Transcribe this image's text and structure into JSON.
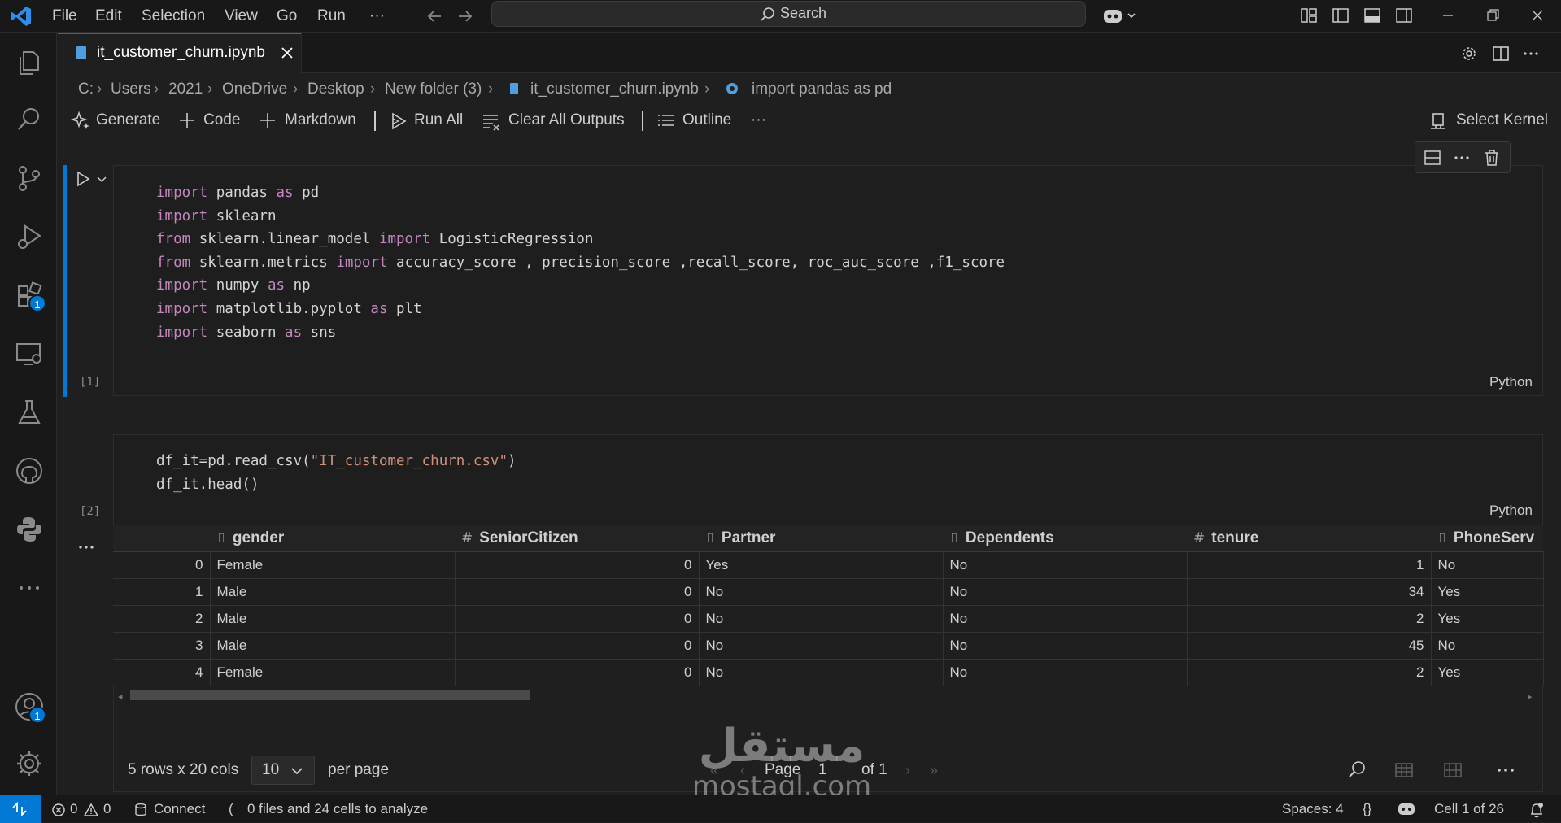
{
  "menu": [
    "File",
    "Edit",
    "Selection",
    "View",
    "Go",
    "Run",
    "···"
  ],
  "search": {
    "label": "Search"
  },
  "tab": {
    "title": "it_customer_churn.ipynb"
  },
  "breadcrumb": [
    "C:",
    "Users",
    "2021",
    "OneDrive",
    "Desktop",
    "New folder (3)",
    "it_customer_churn.ipynb",
    "import pandas as pd"
  ],
  "toolbar": {
    "generate": "Generate",
    "code": "Code",
    "markdown": "Markdown",
    "run_all": "Run All",
    "clear_outputs": "Clear All Outputs",
    "outline": "Outline",
    "more": "···",
    "select_kernel": "Select Kernel"
  },
  "badges": {
    "extensions": "1",
    "accounts": "1"
  },
  "cells": [
    {
      "exec_count": "[1]",
      "language": "Python",
      "lines": [
        [
          {
            "t": "import",
            "c": "kw"
          },
          {
            "t": " pandas "
          },
          {
            "t": "as",
            "c": "kw"
          },
          {
            "t": " pd"
          }
        ],
        [
          {
            "t": "import",
            "c": "kw"
          },
          {
            "t": " sklearn"
          }
        ],
        [
          {
            "t": "from",
            "c": "kw"
          },
          {
            "t": " sklearn.linear_model "
          },
          {
            "t": "import",
            "c": "kw"
          },
          {
            "t": " LogisticRegression"
          }
        ],
        [
          {
            "t": "from",
            "c": "kw"
          },
          {
            "t": " sklearn.metrics "
          },
          {
            "t": "import",
            "c": "kw"
          },
          {
            "t": " accuracy_score , precision_score ,recall_score, roc_auc_score ,f1_score"
          }
        ],
        [
          {
            "t": "import",
            "c": "kw"
          },
          {
            "t": " numpy "
          },
          {
            "t": "as",
            "c": "kw"
          },
          {
            "t": " np"
          }
        ],
        [
          {
            "t": "import",
            "c": "kw"
          },
          {
            "t": " matplotlib.pyplot "
          },
          {
            "t": "as",
            "c": "kw"
          },
          {
            "t": " plt"
          }
        ],
        [
          {
            "t": "import",
            "c": "kw"
          },
          {
            "t": " seaborn "
          },
          {
            "t": "as",
            "c": "kw"
          },
          {
            "t": " sns"
          }
        ]
      ]
    },
    {
      "exec_count": "[2]",
      "language": "Python",
      "lines": [
        [
          {
            "t": "df_it=pd.read_csv("
          },
          {
            "t": "\"IT_customer_churn.csv\"",
            "c": "str"
          },
          {
            "t": ")"
          }
        ],
        [
          {
            "t": "df_it.head()"
          }
        ]
      ]
    }
  ],
  "dataframe": {
    "columns": [
      {
        "name": "gender",
        "type": "text"
      },
      {
        "name": "SeniorCitizen",
        "type": "number"
      },
      {
        "name": "Partner",
        "type": "text"
      },
      {
        "name": "Dependents",
        "type": "text"
      },
      {
        "name": "tenure",
        "type": "number"
      },
      {
        "name": "PhoneServ",
        "type": "text"
      }
    ],
    "rows": [
      {
        "index": "0",
        "values": [
          "Female",
          "0",
          "Yes",
          "No",
          "1",
          "No"
        ]
      },
      {
        "index": "1",
        "values": [
          "Male",
          "0",
          "No",
          "No",
          "34",
          "Yes"
        ]
      },
      {
        "index": "2",
        "values": [
          "Male",
          "0",
          "No",
          "No",
          "2",
          "Yes"
        ]
      },
      {
        "index": "3",
        "values": [
          "Male",
          "0",
          "No",
          "No",
          "45",
          "No"
        ]
      },
      {
        "index": "4",
        "values": [
          "Female",
          "0",
          "No",
          "No",
          "2",
          "Yes"
        ]
      }
    ],
    "summary": "5 rows x 20 cols",
    "per_page_value": "10",
    "per_page_label": "per page",
    "page_label": "Page",
    "page_value": "1",
    "of_label": "of 1"
  },
  "statusbar": {
    "errors": "0",
    "warnings": "0",
    "connect": "Connect",
    "analyze": "0 files and 24 cells to analyze",
    "spaces": "Spaces: 4",
    "braces": "{}",
    "cell_position": "Cell 1 of 26"
  },
  "watermark": {
    "arabic": "مستقل",
    "latin": "mostaql.com"
  },
  "colors": {
    "accent": "#0078d4",
    "keyword": "#c586c0",
    "string": "#ce9178"
  }
}
